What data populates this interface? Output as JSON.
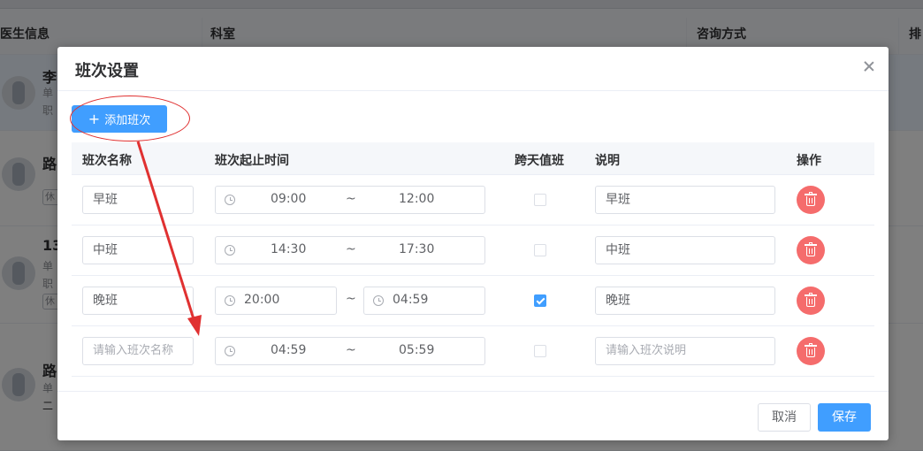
{
  "background": {
    "columns": [
      "医生信息",
      "科室",
      "咨询方式",
      "排"
    ],
    "rows": [
      {
        "name": "李",
        "line1": "单",
        "line2": "职"
      },
      {
        "name": "路",
        "line1": "",
        "line2": "",
        "tag": "休"
      },
      {
        "name": "13",
        "line1": "单",
        "line2": "职",
        "tag": "休"
      },
      {
        "name": "路",
        "line1": "单",
        "line2": "二"
      }
    ]
  },
  "dialog": {
    "title": "班次设置",
    "add_button": "添加班次",
    "columns": {
      "name": "班次名称",
      "time": "班次起止时间",
      "overnight": "跨天值班",
      "desc": "说明",
      "action": "操作"
    },
    "range_separator": "~",
    "rows": [
      {
        "name": "早班",
        "start": "09:00",
        "end": "12:00",
        "overnight": false,
        "desc": "早班"
      },
      {
        "name": "中班",
        "start": "14:30",
        "end": "17:30",
        "overnight": false,
        "desc": "中班"
      },
      {
        "name": "晚班",
        "start": "20:00",
        "end": "04:59",
        "overnight": true,
        "desc": "晚班"
      },
      {
        "name": "",
        "start": "04:59",
        "end": "05:59",
        "overnight": false,
        "desc": ""
      }
    ],
    "placeholders": {
      "name": "请输入班次名称",
      "desc": "请输入班次说明"
    },
    "cancel_button": "取消",
    "save_button": "保存"
  },
  "colors": {
    "primary": "#409eff",
    "danger": "#f56c6c",
    "annotation": "#e03131"
  },
  "icons": {
    "close": "close-icon",
    "clock": "clock-icon",
    "delete": "trash-icon",
    "plus": "plus-icon"
  }
}
